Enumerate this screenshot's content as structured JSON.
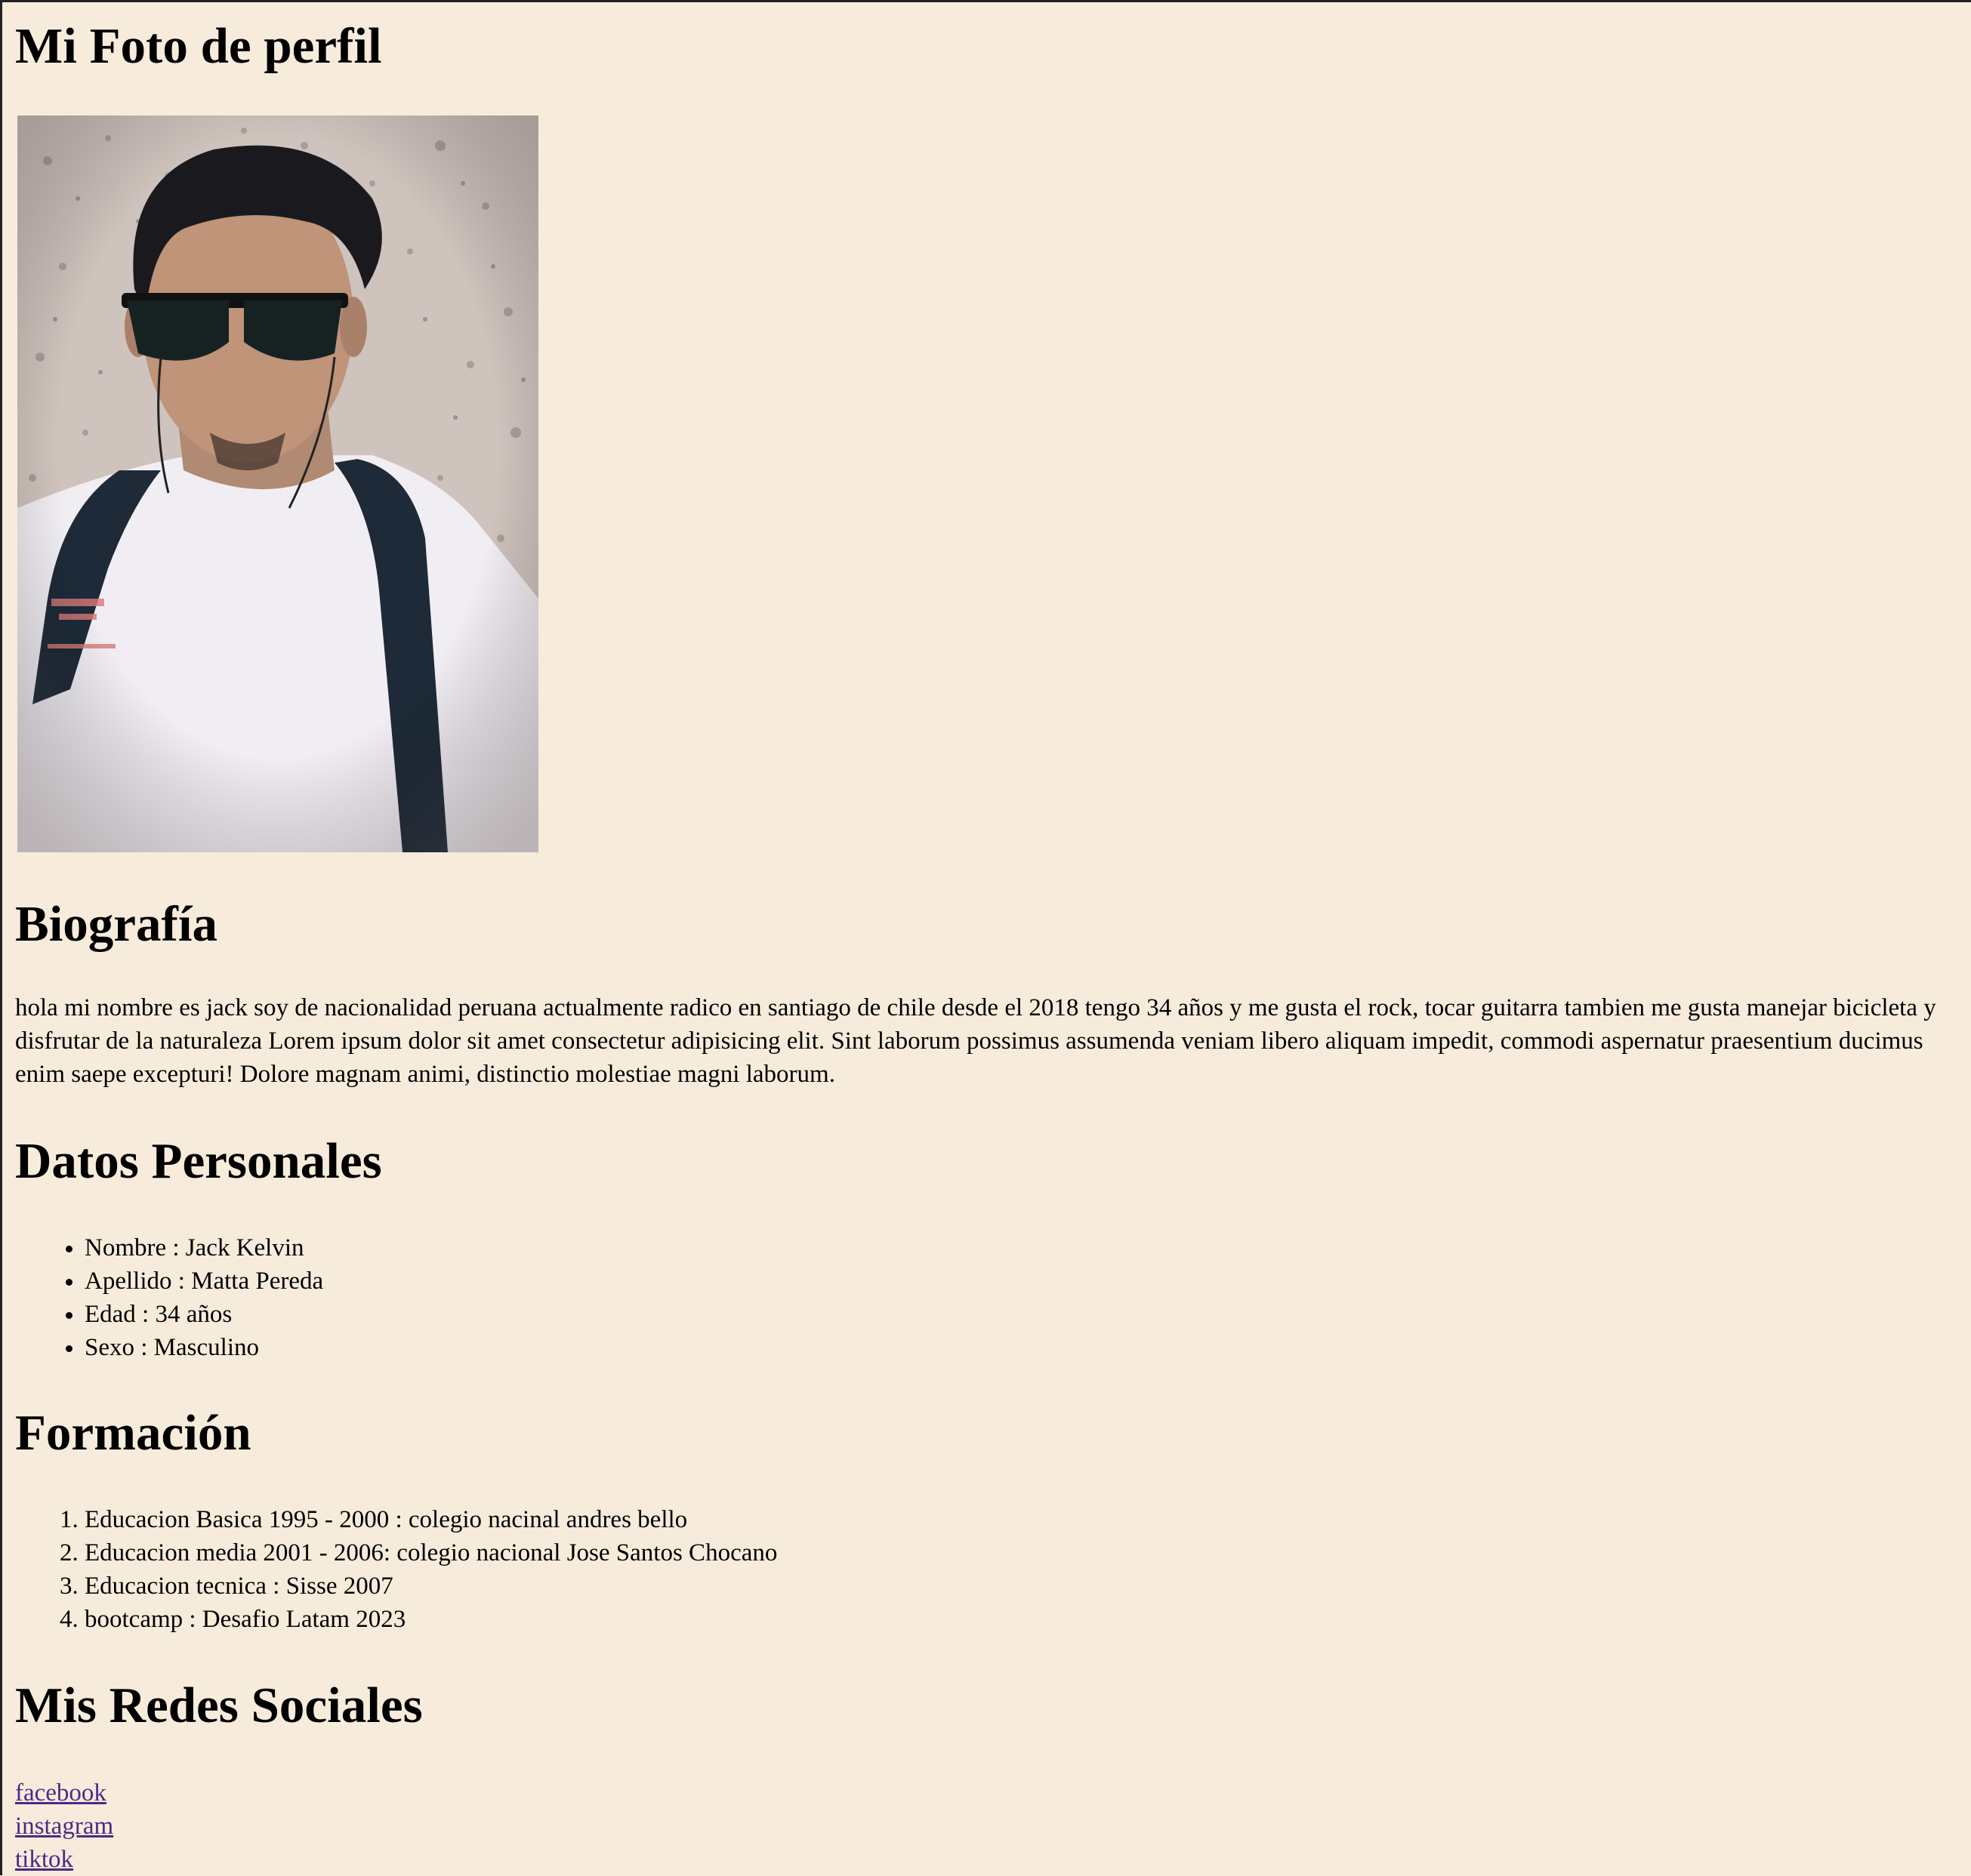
{
  "page": {
    "background": "#f7ecdb",
    "link_color": "#4b2a87"
  },
  "profile_photo": {
    "title": "Mi Foto de perfil",
    "image": "photo of a man wearing sunglasses, white t-shirt and backpack in front of a granite wall"
  },
  "biography": {
    "title": "Biografía",
    "text": "hola mi nombre es jack soy de nacionalidad peruana actualmente radico en santiago de chile desde el 2018 tengo 34 años y me gusta el rock, tocar guitarra tambien me gusta manejar bicicleta y disfrutar de la naturaleza Lorem ipsum dolor sit amet consectetur adipisicing elit. Sint laborum possimus assumenda veniam libero aliquam impedit, commodi aspernatur praesentium ducimus enim saepe excepturi! Dolore magnam animi, distinctio molestiae magni laborum."
  },
  "personal_data": {
    "title": "Datos Personales",
    "items": [
      "Nombre : Jack Kelvin",
      "Apellido : Matta Pereda",
      "Edad : 34 años",
      "Sexo : Masculino"
    ]
  },
  "education": {
    "title": "Formación",
    "items": [
      "Educacion Basica 1995 - 2000 : colegio nacinal andres bello",
      "Educacion media 2001 - 2006: colegio nacional Jose Santos Chocano",
      "Educacion tecnica : Sisse 2007",
      "bootcamp : Desafio Latam 2023"
    ]
  },
  "social": {
    "title": "Mis Redes Sociales",
    "links": [
      "facebook",
      "instagram",
      "tiktok"
    ]
  }
}
